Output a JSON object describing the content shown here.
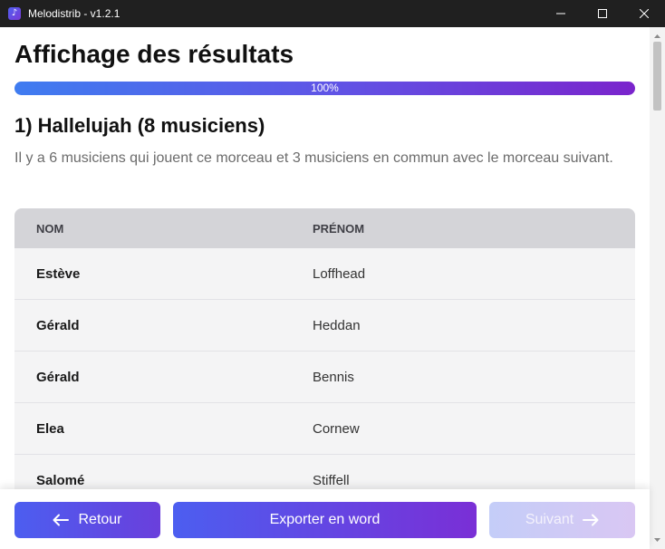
{
  "window": {
    "title": "Melodistrib - v1.2.1",
    "icon": "music-note-icon"
  },
  "page": {
    "title": "Affichage des résultats",
    "progress_label": "100%",
    "progress_value": 100
  },
  "section": {
    "title": "1) Hallelujah (8 musiciens)",
    "description": "Il y a 6 musiciens qui jouent ce morceau et 3 musiciens en commun avec le morceau suivant."
  },
  "table": {
    "headers": [
      "NOM",
      "PRÉNOM"
    ],
    "rows": [
      [
        "Estève",
        "Loffhead"
      ],
      [
        "Gérald",
        "Heddan"
      ],
      [
        "Gérald",
        "Bennis"
      ],
      [
        "Elea",
        "Cornew"
      ],
      [
        "Salomé",
        "Stiffell"
      ]
    ]
  },
  "footer": {
    "back_label": "Retour",
    "export_label": "Exporter en word",
    "next_label": "Suivant"
  },
  "colors": {
    "titlebar": "#202020",
    "accent_start": "#4c5ef0",
    "accent_end": "#7a2fd6",
    "table_header": "#d4d4d8",
    "table_row": "#f4f4f5"
  }
}
